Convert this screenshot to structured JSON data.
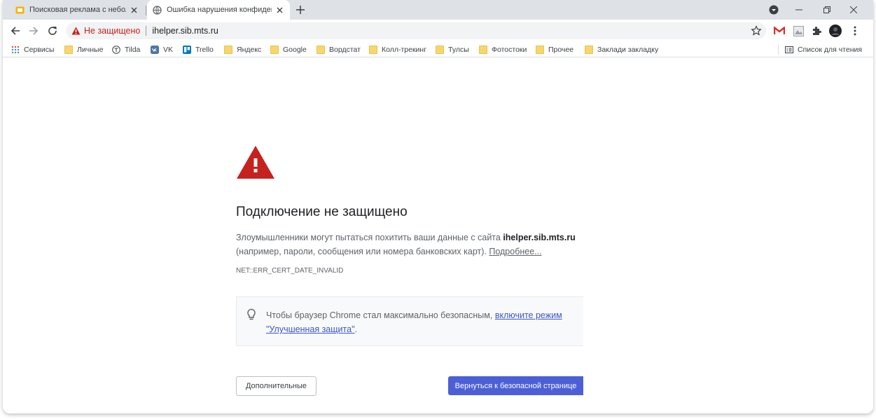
{
  "tabs": [
    {
      "title": "Поисковая реклама с небольш",
      "state": "inactive"
    },
    {
      "title": "Ошибка нарушения конфиденц",
      "state": "active"
    }
  ],
  "omnibox": {
    "security_label": "Не защищено",
    "url": "ihelper.sib.mts.ru"
  },
  "bookmarks": {
    "items": [
      {
        "label": "Сервисы",
        "icon": "apps-grid-icon"
      },
      {
        "label": "Личные",
        "icon": "folder-icon"
      },
      {
        "label": "Tilda",
        "icon": "tilda-icon"
      },
      {
        "label": "VK",
        "icon": "vk-icon"
      },
      {
        "label": "Trello",
        "icon": "trello-icon"
      },
      {
        "label": "Яндекс",
        "icon": "folder-icon"
      },
      {
        "label": "Google",
        "icon": "folder-icon"
      },
      {
        "label": "Вордстат",
        "icon": "folder-icon"
      },
      {
        "label": "Колл-трекинг",
        "icon": "folder-icon"
      },
      {
        "label": "Тулсы",
        "icon": "folder-icon"
      },
      {
        "label": "Фотостоки",
        "icon": "folder-icon"
      },
      {
        "label": "Прочее",
        "icon": "folder-icon"
      },
      {
        "label": "Заклади закладку",
        "icon": "folder-icon"
      }
    ],
    "reading_list": "Список для чтения"
  },
  "page": {
    "heading": "Подключение не защищено",
    "desc_before": "Злоумышленники могут пытаться похитить ваши данные с сайта ",
    "desc_domain": "ihelper.sib.mts.ru",
    "desc_after": " (например, пароли, сообщения или номера банковских карт). ",
    "desc_link": "Подробнее...",
    "error_code": "NET::ERR_CERT_DATE_INVALID",
    "tip_before": "Чтобы браузер Chrome стал максимально безопасным, ",
    "tip_link": "включите режим \"Улучшенная защита\"",
    "tip_after": ".",
    "advanced_button": "Дополнительные",
    "back_button": "Вернуться к безопасной странице"
  },
  "colors": {
    "warning_red": "#c5221f",
    "primary_button": "#4c5fd6",
    "tabstrip": "#dee1e6"
  }
}
